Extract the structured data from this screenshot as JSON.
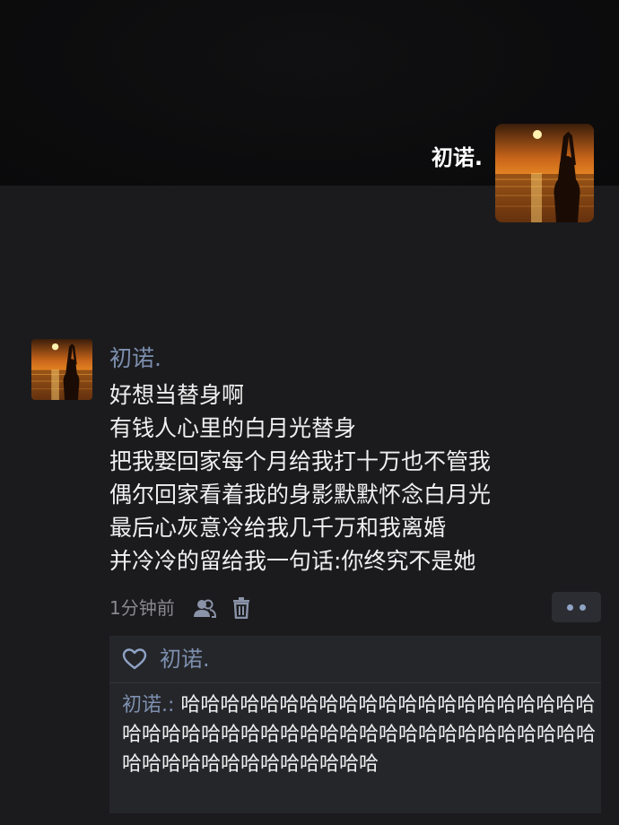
{
  "profile": {
    "name": "初诺."
  },
  "post": {
    "author": "初诺.",
    "lines": [
      "好想当替身啊",
      "有钱人心里的白月光替身",
      "把我娶回家每个月给我打十万也不管我",
      "偶尔回家看着我的身影默默怀念白月光",
      "最后心灰意冷给我几千万和我离婚",
      "并冷冷的留给我一句话:你终究不是她"
    ],
    "time": "1分钟前"
  },
  "likes": {
    "names": "初诺."
  },
  "comments": [
    {
      "author": "初诺.",
      "separator": ": ",
      "text": "哈哈哈哈哈哈哈哈哈哈哈哈哈哈哈哈哈哈哈哈哈哈哈哈哈哈哈哈哈哈哈哈哈哈哈哈哈哈哈哈哈哈哈哈哈哈哈哈哈哈哈哈哈哈哈哈哈哈"
    }
  ],
  "colors": {
    "background": "#1b1b1e",
    "cover": "#0a0a0b",
    "name_link": "#7d8fae",
    "text": "#f0f0f0",
    "secondary": "#8a8a8e",
    "comment_bg": "#25262a"
  },
  "icons": {
    "privacy": "people-icon",
    "delete": "trash-icon",
    "more": "more-dots-icon",
    "like": "heart-icon"
  }
}
